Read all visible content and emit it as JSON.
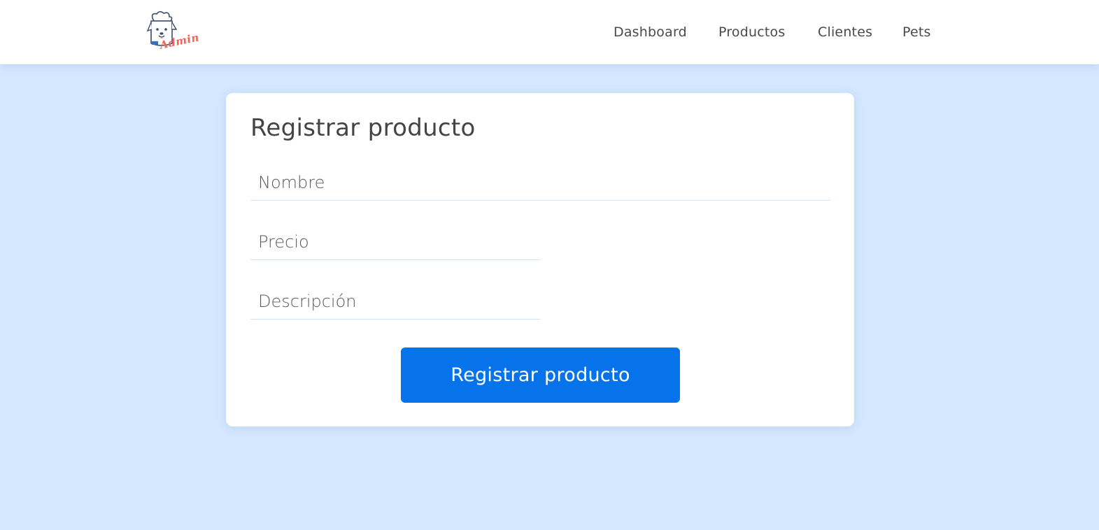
{
  "header": {
    "logo": {
      "icon": "dog-chef-logo",
      "text": "Admin",
      "text_color": "#f0625a"
    },
    "nav": [
      {
        "label": "Dashboard"
      },
      {
        "label": "Productos"
      },
      {
        "label": "Clientes"
      },
      {
        "label": "Pets"
      }
    ]
  },
  "form": {
    "title": "Registrar producto",
    "fields": {
      "nombre": {
        "placeholder": "Nombre",
        "value": ""
      },
      "precio": {
        "placeholder": "Precio",
        "value": ""
      },
      "descripcion": {
        "placeholder": "Descripción",
        "value": ""
      }
    },
    "submit_label": "Registrar producto"
  },
  "colors": {
    "page_background": "#d4e7fe",
    "card_background": "#ffffff",
    "primary_button": "#0673ea",
    "text": "#444444"
  }
}
